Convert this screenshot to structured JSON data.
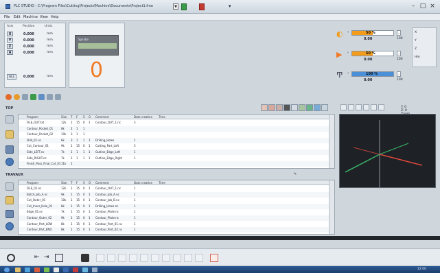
{
  "window": {
    "title": "PLC STUDIO - C:\\Program Files\\Cutting\\Projects\\Machine\\Documents\\Project1.fme",
    "profile_select": "▼"
  },
  "menu": [
    "File",
    "Edit",
    "Machine",
    "View",
    "Help"
  ],
  "dro": {
    "headers": [
      "Axis",
      "Position",
      "Units"
    ],
    "rows": [
      {
        "axis": "X",
        "value": "0.000",
        "unit": "mm"
      },
      {
        "axis": "Y",
        "value": "0.000",
        "unit": "mm"
      },
      {
        "axis": "Z",
        "value": "0.000",
        "unit": "mm"
      },
      {
        "axis": "A",
        "value": "0.000",
        "unit": "mm"
      }
    ],
    "reset_label": "ALL",
    "reset_value": "0.000",
    "reset_unit": "mm"
  },
  "status": {
    "spindle_label": "Spindle",
    "big_counter": "0"
  },
  "overrides": [
    {
      "icon": "feed",
      "percent": "50 %",
      "fill": 0.5,
      "value": "0.00",
      "max": "100",
      "color": "#f39b1a"
    },
    {
      "icon": "rapid",
      "percent": "50 %",
      "fill": 0.5,
      "value": "0.00",
      "max": "100",
      "color": "#f39b1a"
    },
    {
      "icon": "spindle",
      "percent": "100 %",
      "fill": 1.0,
      "value": "0.00",
      "max": "100",
      "color": "#4a8fd8"
    }
  ],
  "side_panel": [
    "X",
    "Y",
    "Z",
    "Hm"
  ],
  "sections": {
    "top_label": "TOP",
    "bottom_label": "TRAVAUX"
  },
  "top_table": {
    "columns": [
      "Program",
      "Size",
      "T",
      "F",
      "S",
      "O",
      "Comment",
      "Date creation",
      "Time"
    ],
    "rows": [
      [
        "FILE_OUT.txt",
        "12k",
        "1",
        "15",
        "0",
        "1",
        "Contour_OUT_1.nc",
        "3",
        ""
      ],
      [
        "Contour_Pocket_01",
        "8k",
        "2",
        "1",
        "1",
        "",
        "",
        "",
        ""
      ],
      [
        "Contour_Pocket_02",
        "10k",
        "3",
        "1",
        "1",
        "",
        "",
        "",
        ""
      ],
      [
        "Drill_01.nc",
        "6k",
        "3",
        "1",
        "1",
        "1",
        "Drilling_Holes",
        "1",
        ""
      ],
      [
        "Cut_Contour_01",
        "9k",
        "1",
        "15",
        "0",
        "1",
        "Cutting_Part_Left",
        "3",
        ""
      ],
      [
        "Side_LEFT.nc",
        "7k",
        "1",
        "1",
        "1",
        "1",
        "Outline_Edge_Left",
        "1",
        ""
      ],
      [
        "Side_RIGHT.nc",
        "7k",
        "1",
        "1",
        "1",
        "1",
        "Outline_Edge_Right",
        "1",
        ""
      ],
      [
        "Finish_Pass_Final_Cut_01",
        "11k",
        "1",
        "",
        "",
        "",
        "",
        "",
        ""
      ]
    ]
  },
  "bottom_table": {
    "columns": [
      "Program",
      "Size",
      "T",
      "F",
      "S",
      "O",
      "Comment",
      "Date creation",
      "Time"
    ],
    "rows": [
      [
        "FILE_01.nc",
        "12k",
        "1",
        "15",
        "0",
        "1",
        "Contour_OUT_1.nc",
        "1",
        ""
      ],
      [
        "Batch_Job_A.nc",
        "9k",
        "1",
        "15",
        "0",
        "1",
        "Contour_Job_A.nc",
        "1",
        ""
      ],
      [
        "Cut_Outer_01",
        "10k",
        "1",
        "15",
        "0",
        "1",
        "Contour_Job_B.nc",
        "1",
        ""
      ],
      [
        "Cut_Inner_Hole_01",
        "8k",
        "1",
        "15",
        "0",
        "1",
        "Drilling_Holes.nc",
        "1",
        ""
      ],
      [
        "Edge_01.nc",
        "7k",
        "1",
        "15",
        "0",
        "1",
        "Contour_Plate.nc",
        "1",
        ""
      ],
      [
        "Contour_Outer_02",
        "9k",
        "1",
        "15",
        "0",
        "1",
        "Contour_Plate.nc",
        "1",
        ""
      ],
      [
        "Contour_Part_LOW",
        "8k",
        "1",
        "15",
        "0",
        "1",
        "Contour_Part_01.nc",
        "1",
        ""
      ],
      [
        "Contour_Part_END",
        "8k",
        "1",
        "15",
        "0",
        "1",
        "Contour_Part_02.nc",
        "1",
        ""
      ]
    ]
  },
  "sim_toolbar": {
    "label": "Y: 0  Z: 0  Zoom"
  },
  "taskbar": {
    "clock": "12:00"
  },
  "colors": {
    "orange": "#f07a24",
    "feed_bar": "#f39b1a",
    "spindle_bar": "#4a8fd8",
    "axis_x": "#e0473c",
    "axis_y": "#3ab36a",
    "axis_z": "#9aa4ad"
  }
}
